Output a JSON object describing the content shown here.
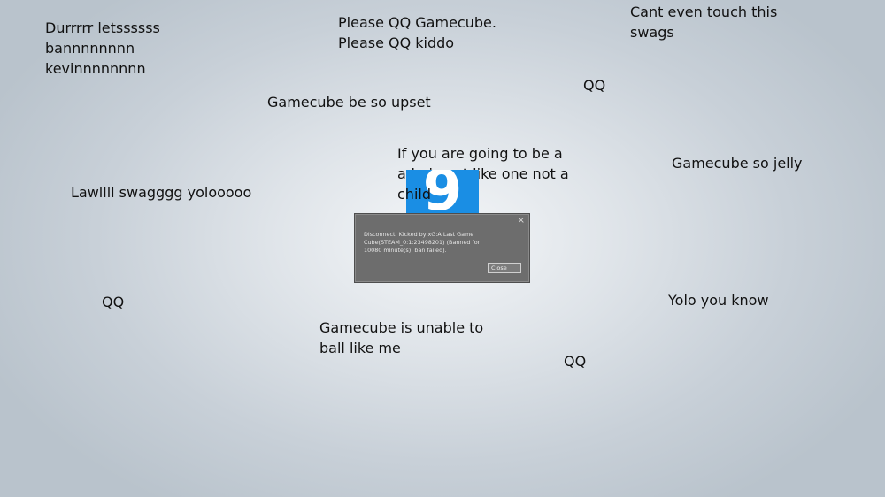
{
  "annotations": {
    "durrr": [
      "Durrrrr letssssss",
      "bannnnnnnn",
      "kevinnnnnnnn"
    ],
    "please_qq": [
      "Please QQ Gamecube.",
      "Please QQ kiddo"
    ],
    "cant_touch": [
      "Cant even touch this",
      "swags"
    ],
    "qq_top": "QQ",
    "upset": "Gamecube be so upset",
    "admin": [
      "If you are going to be a",
      "admin act like one not a",
      "child"
    ],
    "jelly": "Gamecube so jelly",
    "lawl": "Lawllll swagggg yolooooo",
    "qq_left": "QQ",
    "yolo": "Yolo you know",
    "unable": [
      "Gamecube is unable to",
      "ball like me"
    ],
    "qq_bottom": "QQ"
  },
  "logo": {
    "glyph": "9",
    "color": "#1a8ee4"
  },
  "dialog": {
    "close_glyph": "×",
    "message": "Disconnect: Kicked by xG:A Last Game Cube(STEAM_0:1:23498201) (Banned for 10080 minute(s): ban failed).",
    "button_label": "Close"
  }
}
